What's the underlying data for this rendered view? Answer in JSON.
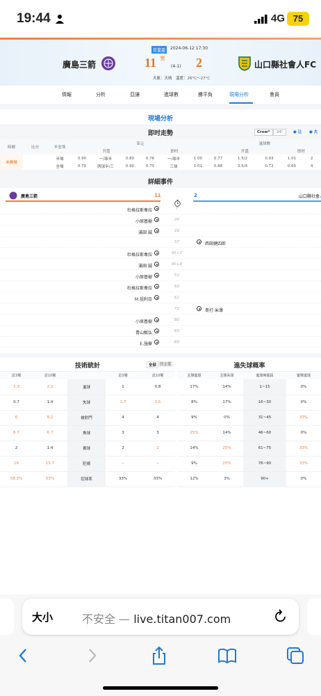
{
  "status": {
    "time": "19:44",
    "network": "4G",
    "battery": "75"
  },
  "match": {
    "home": "廣島三箭",
    "away": "山口縣社會人FC",
    "home_score": "11",
    "away_score": "2",
    "league_badge": "日皇盃",
    "datetime": "2024-06-12 17:30",
    "status": "完",
    "halftime": "(4-1)",
    "weather": "天氣：天晴　溫度：26°C～27°C"
  },
  "tabs": [
    "情報",
    "分析",
    "亞讓",
    "進球數",
    "勝平負",
    "現場分析",
    "會員"
  ],
  "active_tab": "現場分析",
  "live": {
    "section_title": "現場分析",
    "trend_title": "即时走勢",
    "company": "Crow*",
    "minute_sel": "36'",
    "chk1": "让",
    "chk2": "大",
    "odds_headers": {
      "time": "時間",
      "score": "比分",
      "half": "半全场",
      "handicap": "亚让",
      "total": "進球數",
      "init": "开盘",
      "live": "即时",
      "init2": "开盘",
      "live2": "即时"
    },
    "odds_rows": [
      {
        "time": "未開場",
        "type": "半場",
        "h1": "0.90",
        "h2": "一/球半",
        "h3": "0.80",
        "l1": "0.76",
        "l2": "一/球半",
        "l3": "1.00",
        "t1": "0.77",
        "t2": "1.5/2",
        "t3": "0.93",
        "t4": "1.01",
        "t5": "2"
      },
      {
        "time": "",
        "type": "全場",
        "h1": "0.70",
        "h2": "两球半/三",
        "h3": "0.90",
        "l1": "0.75",
        "l2": "三球",
        "l3": "1.01",
        "t1": "0.88",
        "t2": "3.5/4",
        "t3": "0.72",
        "t4": "0.65",
        "t5": "4"
      }
    ]
  },
  "events": {
    "title": "詳細事件",
    "home": "廣島三箭",
    "away": "山口縣社會人",
    "home_score": "11",
    "away_score": "2",
    "rows": [
      {
        "min": "7'",
        "home": "杜格拉斯韋拉",
        "away": ""
      },
      {
        "min": "26'",
        "home": "小原基樹",
        "away": ""
      },
      {
        "min": "29'",
        "home": "滿田 誠",
        "away": ""
      },
      {
        "min": "37'",
        "home": "",
        "away": "西田健四郎"
      },
      {
        "min": "45+2'",
        "home": "杜格拉斯韋拉",
        "away": ""
      },
      {
        "min": "45+4'",
        "home": "滿田 誠",
        "away": ""
      },
      {
        "min": "51'",
        "home": "小原基樹",
        "away": ""
      },
      {
        "min": "59'",
        "home": "杜格拉斯韋拉",
        "away": ""
      },
      {
        "min": "61'",
        "home": "M.祖利亞",
        "away": ""
      },
      {
        "min": "72'",
        "home": "",
        "away": "哥打·米澤"
      },
      {
        "min": "80'",
        "home": "小原基樹",
        "away": ""
      },
      {
        "min": "83'",
        "home": "青山敏弘",
        "away": ""
      },
      {
        "min": "89'",
        "home": "E.施華",
        "away": ""
      }
    ]
  },
  "tech": {
    "title": "技術統計",
    "all": "全部",
    "same": "同主客",
    "headers": [
      "近3場",
      "近10場",
      "",
      "近3場",
      "近10場"
    ],
    "rows": [
      {
        "a": "2.3",
        "b": "2.2",
        "label": "進球",
        "c": "1",
        "d": "0.8",
        "ao": true,
        "bo": true,
        "co": false,
        "do": false
      },
      {
        "a": "0.7",
        "b": "1.4",
        "label": "失球",
        "c": "1.7",
        "d": "1.5",
        "ao": false,
        "bo": false,
        "co": true,
        "do": true
      },
      {
        "a": "6",
        "b": "8.2",
        "label": "被射門",
        "c": "4",
        "d": "4",
        "ao": true,
        "bo": true,
        "co": false,
        "do": false
      },
      {
        "a": "6.7",
        "b": "6.7",
        "label": "角球",
        "c": "3",
        "d": "3",
        "ao": true,
        "bo": true,
        "co": false,
        "do": false
      },
      {
        "a": "2",
        "b": "1.4",
        "label": "黃球",
        "c": "2",
        "d": "2",
        "ao": false,
        "bo": false,
        "co": false,
        "do": true
      },
      {
        "a": "16",
        "b": "15.7",
        "label": "犯規",
        "c": "-",
        "d": "-",
        "ao": true,
        "bo": true,
        "co": false,
        "do": false
      },
      {
        "a": "58.3%",
        "b": "53%",
        "label": "控球率",
        "c": "33%",
        "d": "33%",
        "ao": true,
        "bo": true,
        "co": false,
        "do": false
      }
    ]
  },
  "prob": {
    "title": "進失球概率",
    "headers": [
      "主隊進球",
      "主隊失球",
      "進球時間段",
      "客隊進球"
    ],
    "rows": [
      {
        "a": "17%",
        "b": "14%",
        "t": "1~15",
        "c": "0%",
        "co": false,
        "ao": false,
        "bo": false
      },
      {
        "a": "8%",
        "b": "17%",
        "t": "16~30",
        "c": "0%",
        "co": false,
        "ao": false,
        "bo": false
      },
      {
        "a": "9%",
        "b": "0%",
        "t": "31~45",
        "c": "33%",
        "co": true,
        "ao": false,
        "bo": false
      },
      {
        "a": "25%",
        "b": "14%",
        "t": "46~60",
        "c": "0%",
        "co": false,
        "ao": true,
        "bo": false
      },
      {
        "a": "14%",
        "b": "25%",
        "t": "61~75",
        "c": "33%",
        "co": true,
        "ao": false,
        "bo": true
      },
      {
        "a": "9%",
        "b": "25%",
        "t": "76~90",
        "c": "33%",
        "co": true,
        "ao": false,
        "bo": true
      },
      {
        "a": "12%",
        "b": "3%",
        "t": "90+",
        "c": "0%",
        "co": false,
        "ao": false,
        "bo": false
      }
    ]
  },
  "browser": {
    "aa": "大小",
    "not_secure": "不安全 — ",
    "url": "live.titan007.com"
  },
  "colors": {
    "accent": "#1d7ad6",
    "orange": "#f07f3c"
  }
}
